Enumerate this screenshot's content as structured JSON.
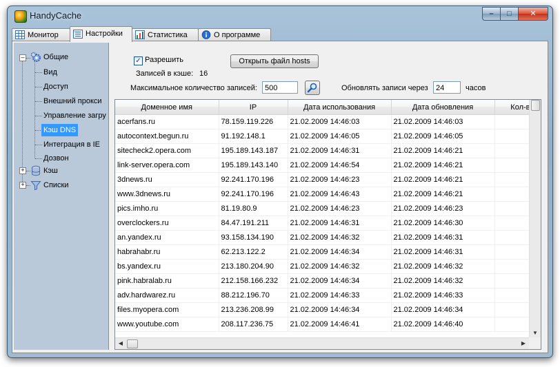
{
  "window": {
    "title": "HandyCache"
  },
  "title_buttons": {
    "minimize": "–",
    "maximize": "□",
    "close": "✕"
  },
  "tabs": [
    {
      "label": "Монитор",
      "icon": "monitor-grid-icon"
    },
    {
      "label": "Настройки",
      "icon": "settings-list-icon",
      "active": true
    },
    {
      "label": "Статистика",
      "icon": "statistics-chart-icon"
    },
    {
      "label": "О программе",
      "icon": "info-icon"
    }
  ],
  "tree": {
    "nodes": [
      {
        "label": "Общие",
        "icon": "gears-icon",
        "expander": "–"
      },
      {
        "label": "Вид"
      },
      {
        "label": "Доступ"
      },
      {
        "label": "Внешний прокси"
      },
      {
        "label": "Управление загру"
      },
      {
        "label": "Кэш DNS",
        "selected": true
      },
      {
        "label": "Интеграция в IE"
      },
      {
        "label": "Дозвон"
      },
      {
        "label": "Кэш",
        "icon": "database-icon",
        "expander": "+"
      },
      {
        "label": "Списки",
        "icon": "filter-funnel-icon",
        "expander": "+"
      }
    ]
  },
  "dns": {
    "enable_label": "Разрешить",
    "enable_checked": true,
    "check_mark": "✓",
    "open_hosts_label": "Открыть файл hosts",
    "records_label": "Записей в кэше:",
    "records_value": "16",
    "max_label": "Максимальное количество записей:",
    "max_value": "500",
    "refresh_label": "Обновлять записи через",
    "refresh_value": "24",
    "hours_label": "часов"
  },
  "table": {
    "columns": [
      "Доменное имя",
      "IP",
      "Дата использования",
      "Дата обновления",
      "Кол-во о"
    ],
    "rows": [
      [
        "acerfans.ru",
        "78.159.119.226",
        "21.02.2009 14:46:03",
        "21.02.2009 14:46:03",
        ""
      ],
      [
        "autocontext.begun.ru",
        "91.192.148.1",
        "21.02.2009 14:46:05",
        "21.02.2009 14:46:05",
        ""
      ],
      [
        "sitecheck2.opera.com",
        "195.189.143.187",
        "21.02.2009 14:46:31",
        "21.02.2009 14:46:21",
        ""
      ],
      [
        "link-server.opera.com",
        "195.189.143.140",
        "21.02.2009 14:46:54",
        "21.02.2009 14:46:21",
        ""
      ],
      [
        "3dnews.ru",
        "92.241.170.196",
        "21.02.2009 14:46:23",
        "21.02.2009 14:46:21",
        ""
      ],
      [
        "www.3dnews.ru",
        "92.241.170.196",
        "21.02.2009 14:46:43",
        "21.02.2009 14:46:21",
        ""
      ],
      [
        "pics.imho.ru",
        "81.19.80.9",
        "21.02.2009 14:46:23",
        "21.02.2009 14:46:23",
        ""
      ],
      [
        "overclockers.ru",
        "84.47.191.211",
        "21.02.2009 14:46:31",
        "21.02.2009 14:46:30",
        ""
      ],
      [
        "an.yandex.ru",
        "93.158.134.190",
        "21.02.2009 14:46:32",
        "21.02.2009 14:46:31",
        ""
      ],
      [
        "habrahabr.ru",
        "62.213.122.2",
        "21.02.2009 14:46:34",
        "21.02.2009 14:46:31",
        ""
      ],
      [
        "bs.yandex.ru",
        "213.180.204.90",
        "21.02.2009 14:46:32",
        "21.02.2009 14:46:32",
        ""
      ],
      [
        "pink.habralab.ru",
        "212.158.166.232",
        "21.02.2009 14:46:34",
        "21.02.2009 14:46:32",
        ""
      ],
      [
        "adv.hardwarez.ru",
        "88.212.196.70",
        "21.02.2009 14:46:33",
        "21.02.2009 14:46:33",
        ""
      ],
      [
        "files.myopera.com",
        "213.236.208.99",
        "21.02.2009 14:46:34",
        "21.02.2009 14:46:34",
        ""
      ],
      [
        "www.youtube.com",
        "208.117.236.75",
        "21.02.2009 14:46:41",
        "21.02.2009 14:46:40",
        ""
      ]
    ]
  },
  "scroll": {
    "up": "▲",
    "down": "▼",
    "left": "◀",
    "right": "▶"
  },
  "colors": {
    "selection": "#3399ff",
    "tree_bg": "#b9c9d9",
    "frame": "#9fbad1"
  }
}
